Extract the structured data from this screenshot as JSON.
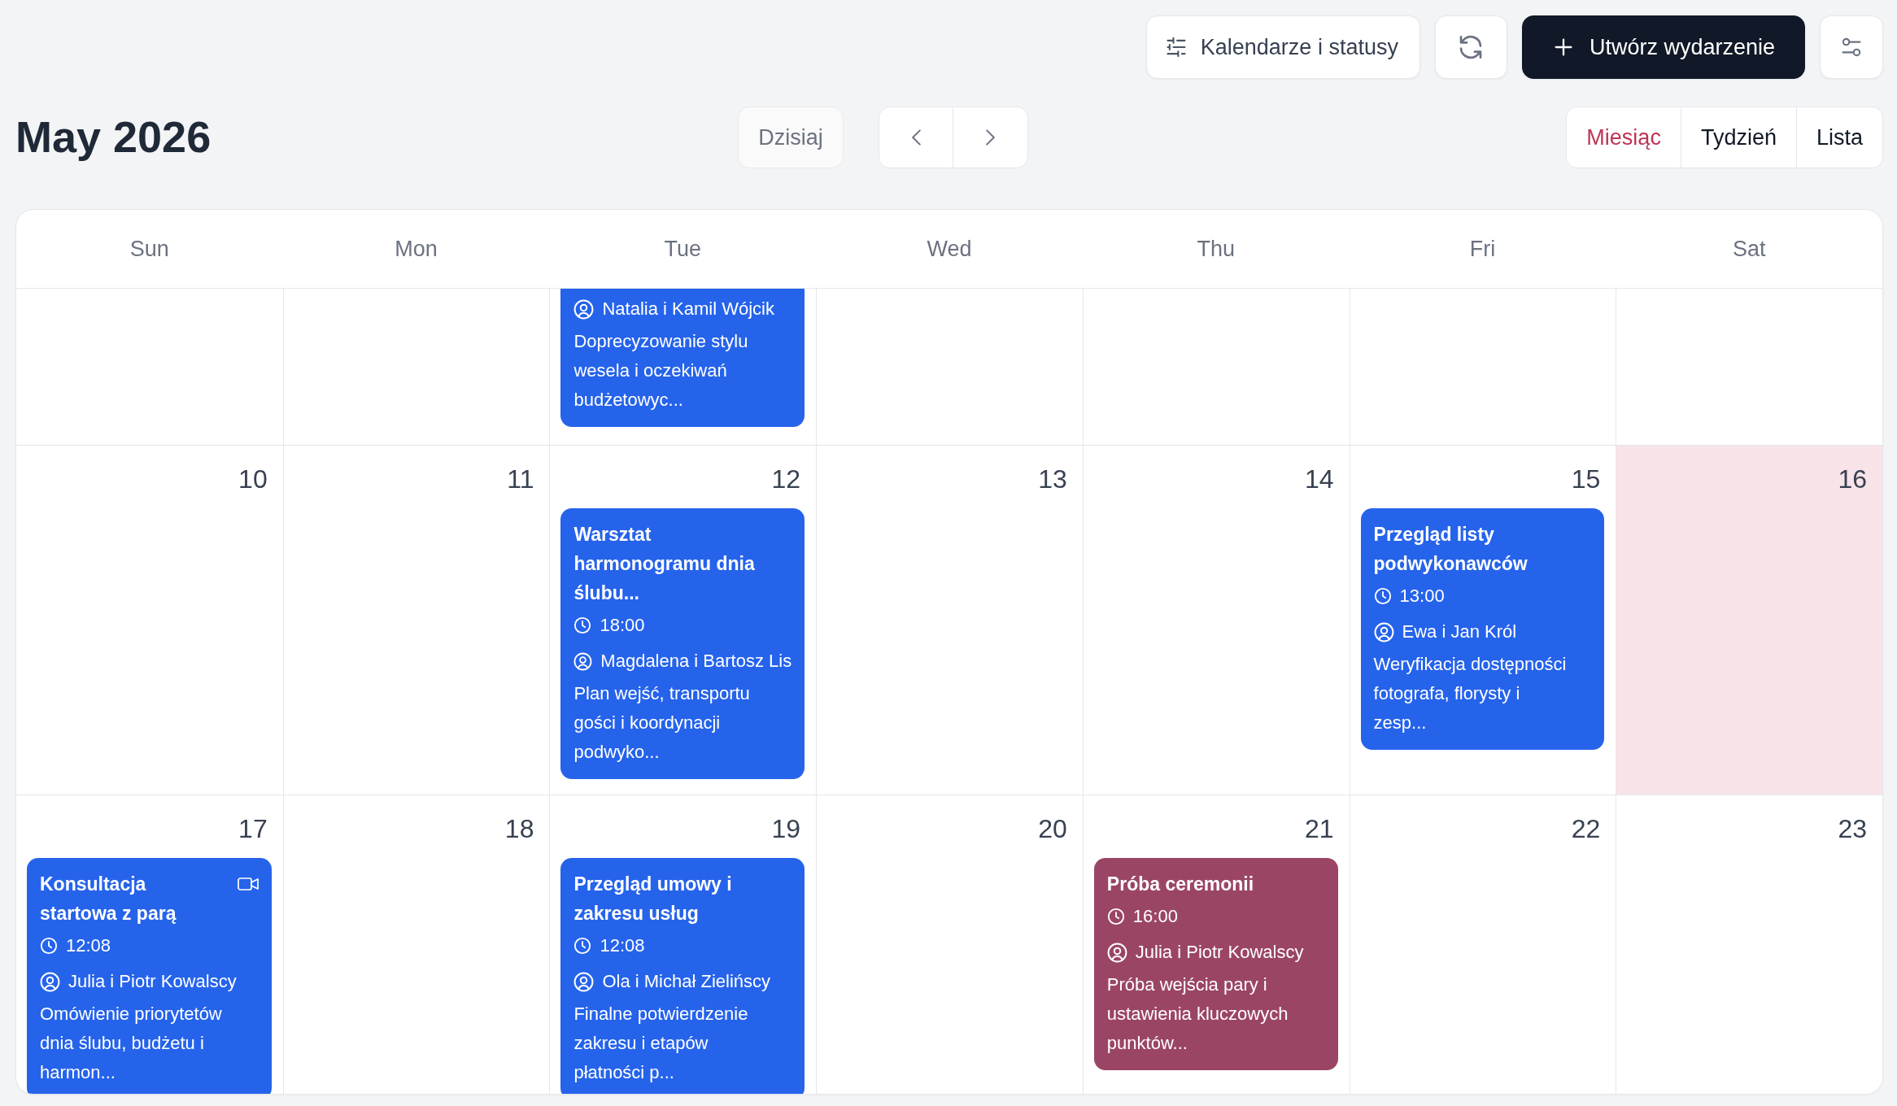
{
  "toolbar": {
    "calendars_button": "Kalendarze i statusy",
    "create_button": "Utwórz wydarzenie"
  },
  "header": {
    "title": "May 2026",
    "today_button": "Dzisiaj",
    "views": [
      {
        "label": "Miesiąc",
        "selected": true
      },
      {
        "label": "Tydzień",
        "selected": false
      },
      {
        "label": "Lista",
        "selected": false
      }
    ]
  },
  "calendar": {
    "weekdays": [
      "Sun",
      "Mon",
      "Tue",
      "Wed",
      "Thu",
      "Fri",
      "Sat"
    ],
    "weeks": [
      {
        "days": [
          {
            "today": false
          },
          {
            "today": false
          },
          {
            "today": false,
            "events": [
              {
                "client": "Natalia i Kamil Wójcik",
                "description": "Doprecyzowanie stylu wesela i oczekiwań budżetowyc...",
                "color": "#2563eb",
                "video": false,
                "continues_above": true
              }
            ]
          },
          {
            "today": false
          },
          {
            "today": false
          },
          {
            "today": false
          },
          {
            "today": false
          }
        ]
      },
      {
        "days": [
          {
            "day": "10",
            "today": false
          },
          {
            "day": "11",
            "today": false
          },
          {
            "day": "12",
            "today": false,
            "events": [
              {
                "title": "Warsztat harmonogramu dnia ślubu...",
                "time": "18:00",
                "client": "Magdalena i Bartosz Lis",
                "description": "Plan wejść, transportu gości i koordynacji podwyko...",
                "color": "#2563eb",
                "video": false,
                "continues_above": false
              }
            ]
          },
          {
            "day": "13",
            "today": false
          },
          {
            "day": "14",
            "today": false
          },
          {
            "day": "15",
            "today": false,
            "events": [
              {
                "title": "Przegląd listy podwykonawców",
                "time": "13:00",
                "client": "Ewa i Jan Król",
                "description": "Weryfikacja dostępności fotografa, florysty i zesp...",
                "color": "#2563eb",
                "video": false,
                "continues_above": false
              }
            ]
          },
          {
            "day": "16",
            "today": true
          }
        ]
      },
      {
        "days": [
          {
            "day": "17",
            "today": false,
            "events": [
              {
                "title": "Konsultacja startowa z parą",
                "time": "12:08",
                "client": "Julia i Piotr Kowalscy",
                "description": "Omówienie priorytetów dnia ślubu, budżetu i harmon...",
                "color": "#2563eb",
                "video": true,
                "continues_above": false
              }
            ]
          },
          {
            "day": "18",
            "today": false
          },
          {
            "day": "19",
            "today": false,
            "events": [
              {
                "title": "Przegląd umowy i zakresu usług",
                "time": "12:08",
                "client": "Ola i Michał Zielińscy",
                "description": "Finalne potwierdzenie zakresu i etapów płatności p...",
                "color": "#2563eb",
                "video": false,
                "continues_above": false
              }
            ]
          },
          {
            "day": "20",
            "today": false
          },
          {
            "day": "21",
            "today": false,
            "events": [
              {
                "title": "Próba ceremonii",
                "time": "16:00",
                "client": "Julia i Piotr Kowalscy",
                "description": "Próba wejścia pary i ustawienia kluczowych punktów...",
                "color": "#9b4566",
                "video": false,
                "continues_above": false
              }
            ]
          },
          {
            "day": "22",
            "today": false
          },
          {
            "day": "23",
            "today": false
          }
        ]
      }
    ]
  }
}
